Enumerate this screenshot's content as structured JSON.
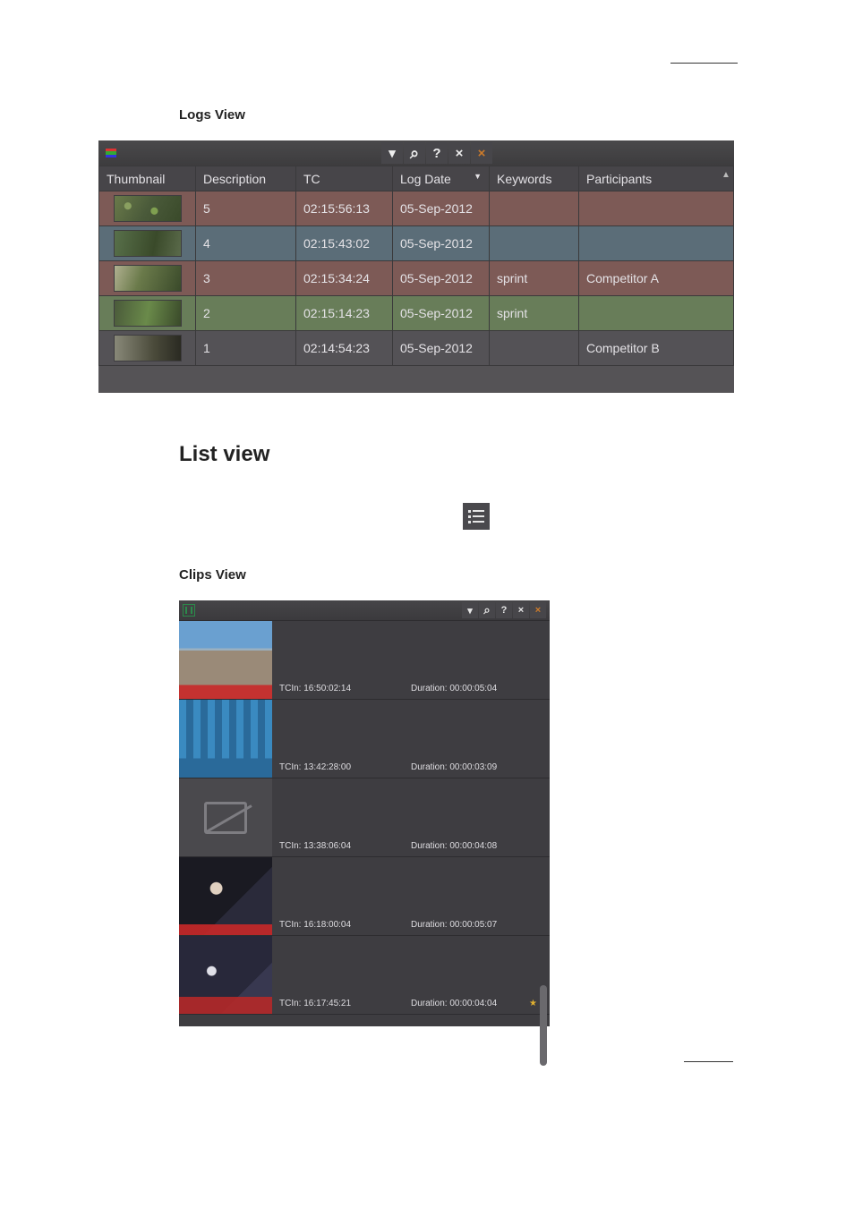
{
  "headings": {
    "logs_view": "Logs View",
    "list_view": "List view",
    "clips_view": "Clips View"
  },
  "logs": {
    "columns": {
      "thumbnail": "Thumbnail",
      "description": "Description",
      "tc": "TC",
      "log_date": "Log Date",
      "keywords": "Keywords",
      "participants": "Participants"
    },
    "rows": [
      {
        "desc": "5",
        "tc": "02:15:56:13",
        "date": "05-Sep-2012",
        "keywords": "",
        "participants": "",
        "tone": "red",
        "thumb": "t1"
      },
      {
        "desc": "4",
        "tc": "02:15:43:02",
        "date": "05-Sep-2012",
        "keywords": "",
        "participants": "",
        "tone": "blue",
        "thumb": "t2"
      },
      {
        "desc": "3",
        "tc": "02:15:34:24",
        "date": "05-Sep-2012",
        "keywords": "sprint",
        "participants": "Competitor A",
        "tone": "red",
        "thumb": "t3"
      },
      {
        "desc": "2",
        "tc": "02:15:14:23",
        "date": "05-Sep-2012",
        "keywords": "sprint",
        "participants": "",
        "tone": "green",
        "thumb": "t4"
      },
      {
        "desc": "1",
        "tc": "02:14:54:23",
        "date": "05-Sep-2012",
        "keywords": "",
        "participants": "Competitor B",
        "tone": "gray",
        "thumb": "t5"
      }
    ]
  },
  "clips": {
    "tc_label": "TCIn:",
    "dur_label": "Duration:",
    "rows": [
      {
        "tc": "16:50:02:14",
        "dur": "00:00:05:04",
        "thumb": "c1",
        "star": false
      },
      {
        "tc": "13:42:28:00",
        "dur": "00:00:03:09",
        "thumb": "c2",
        "star": false
      },
      {
        "tc": "13:38:06:04",
        "dur": "00:00:04:08",
        "thumb": "c3",
        "star": false
      },
      {
        "tc": "16:18:00:04",
        "dur": "00:00:05:07",
        "thumb": "c4",
        "star": false
      },
      {
        "tc": "16:17:45:21",
        "dur": "00:00:04:04",
        "thumb": "c5",
        "star": true
      }
    ]
  },
  "toolbar_glyphs": {
    "dropdown": "▾",
    "search": "⌕",
    "help": "?",
    "close": "×",
    "close2": "×"
  }
}
